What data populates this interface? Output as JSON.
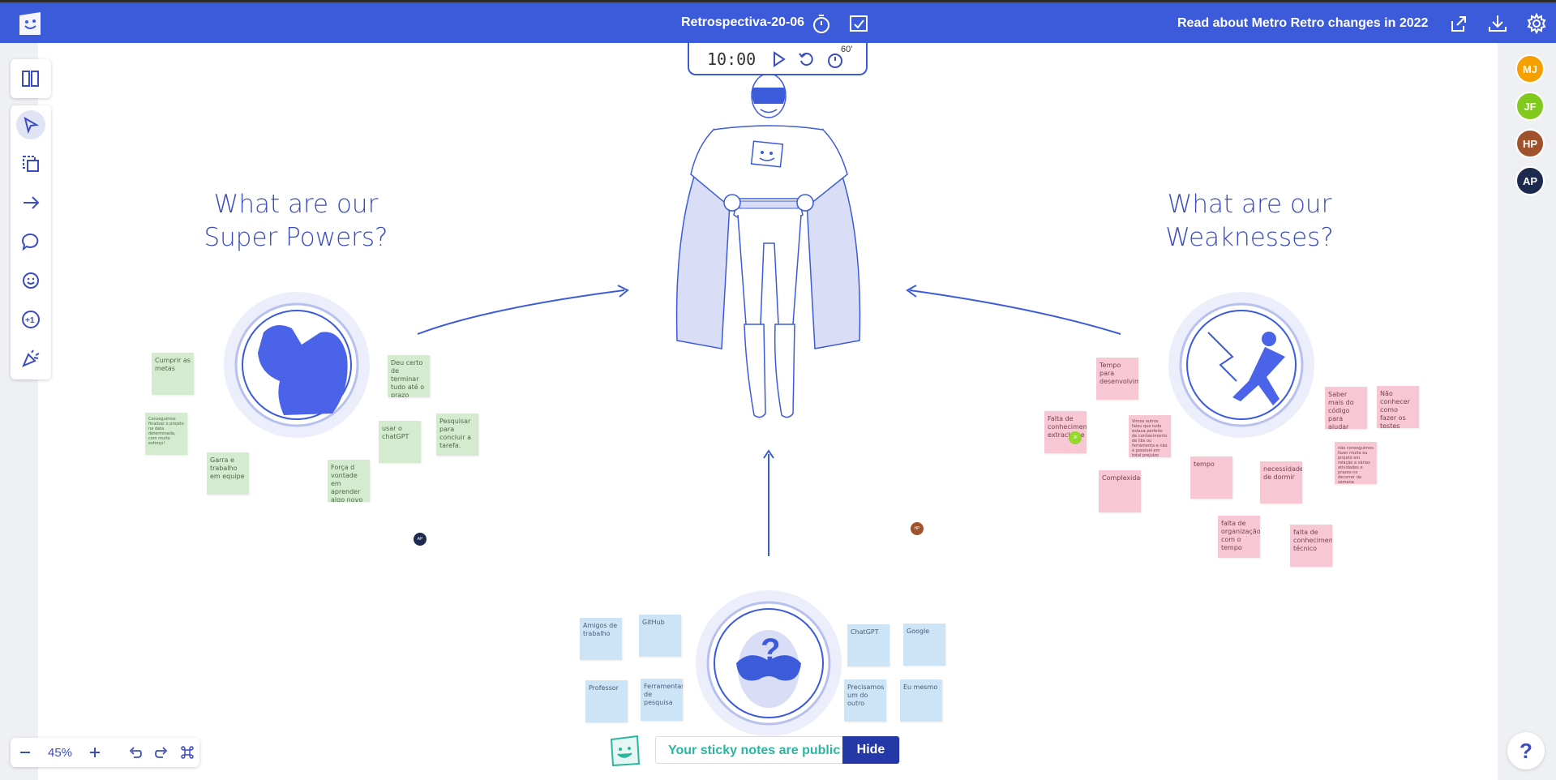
{
  "topbar": {
    "board_title": "Retrospectiva-20-06",
    "metro_link": "Read about Metro Retro changes in 2022"
  },
  "timer": {
    "value": "10:00",
    "preset": "60'"
  },
  "headings": {
    "powers_line1": "What are our",
    "powers_line2": "Super Powers?",
    "weak_line1": "What are our",
    "weak_line2": "Weaknesses?"
  },
  "users": [
    {
      "initials": "MJ",
      "color": "#f59f00"
    },
    {
      "initials": "JF",
      "color": "#82c91e"
    },
    {
      "initials": "HP",
      "color": "#a0522d"
    },
    {
      "initials": "AP",
      "color": "#1b2a4e"
    }
  ],
  "green_notes": [
    "Cumprir as metas",
    "Conseguimos finalizar o projeto na data determinada, com muito esforço!",
    "Garra e trabalho em equipe",
    "Força d vontade em aprender algo novo",
    "usar o chatGPT",
    "Deu certo de terminar tudo até o prazo",
    "Pesquisar para concluir a tarefa."
  ],
  "pink_notes": [
    "Tempo para desenvolvimento",
    "Falta de conhecimento extraclasse",
    "Vimos outros falou que tudo estava perfeito de conhecimento de libs ou ferramenta e não é possível em total prejuízo",
    "Complexidade",
    "tempo",
    "necessidade de dormir",
    "falta de organização com o tempo",
    "falta de conhecimento técnico",
    "Saber mais do código para ajudar",
    "Não conhecer como fazer os testes",
    "não conseguimos fazer muita ou projeto em relação a várias atividades e prazos no decorrer da semana"
  ],
  "blue_notes": [
    "Amigos de trabalho",
    "GitHub",
    "Professor",
    "Ferramentas de pesquisa",
    "ChatGPT",
    "Google",
    "Precisamos um do outro",
    "Eu mesmo"
  ],
  "cursors": [
    {
      "initials": "AP",
      "color": "#1b2a4e"
    },
    {
      "initials": "HP",
      "color": "#a0522d"
    },
    {
      "initials": "JF",
      "color": "#94d82d"
    }
  ],
  "zoom": {
    "level": "45%"
  },
  "public_notice": {
    "text": "Your sticky notes are public",
    "button": "Hide"
  },
  "help": {
    "label": "?"
  }
}
